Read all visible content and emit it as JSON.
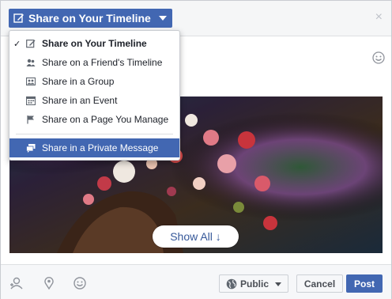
{
  "header": {
    "share_label": "Share on Your Timeline",
    "close_symbol": "×"
  },
  "menu": {
    "items": [
      {
        "label": "Share on Your Timeline",
        "icon": "pencil-icon",
        "checked": true
      },
      {
        "label": "Share on a Friend's Timeline",
        "icon": "friends-icon"
      },
      {
        "label": "Share in a Group",
        "icon": "group-icon"
      },
      {
        "label": "Share in an Event",
        "icon": "calendar-icon"
      },
      {
        "label": "Share on a Page You Manage",
        "icon": "flag-icon"
      },
      {
        "label": "Share in a Private Message",
        "icon": "message-icon",
        "highlighted": true
      }
    ],
    "check_symbol": "✓"
  },
  "preview": {
    "show_all_label": "Show All ↓"
  },
  "footer": {
    "privacy_label": "Public",
    "cancel_label": "Cancel",
    "post_label": "Post"
  },
  "colors": {
    "accent": "#4267b2",
    "link": "#365899",
    "header_bg": "#f5f6f7"
  }
}
